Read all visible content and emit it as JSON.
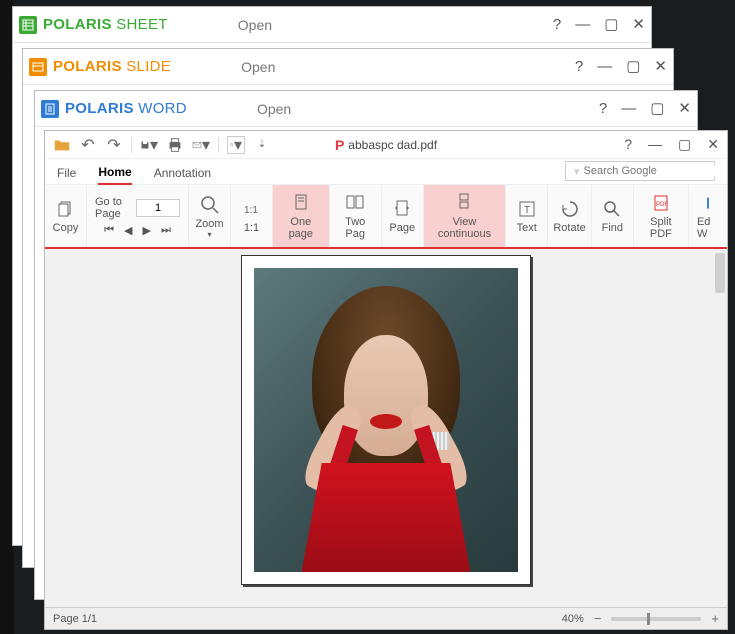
{
  "windows": {
    "sheet": {
      "brand1": "POLARIS ",
      "brand2": "SHEET",
      "action": "Open"
    },
    "slide": {
      "brand1": "POLARIS ",
      "brand2": "SLIDE",
      "action": "Open"
    },
    "word": {
      "brand1": "POLARIS ",
      "brand2": "WORD",
      "action": "Open"
    }
  },
  "title_controls": {
    "help": "?",
    "min": "—",
    "max": "▢",
    "close": "✕"
  },
  "pdf": {
    "doc_prefix": "P",
    "doc_name": "abbaspc dad.pdf",
    "menus": {
      "file": "File",
      "home": "Home",
      "annotation": "Annotation"
    },
    "search_placeholder": "Search Google",
    "ribbon": {
      "copy": "Copy",
      "goto_label": "Go to Page",
      "goto_value": "1",
      "nav": {
        "first": "⏮",
        "prev": "◀",
        "next": "▶",
        "last": "⏭"
      },
      "zoom": "Zoom",
      "one_to_one": "1:1",
      "one_page": "One page",
      "two_page": "Two Pag",
      "page": "Page",
      "view_continuous": "View continuous",
      "text": "Text",
      "rotate": "Rotate",
      "find": "Find",
      "split_pdf": "Split PDF",
      "edit_cut": "Ed W"
    },
    "status": {
      "page": "Page 1/1",
      "zoom": "40%"
    }
  }
}
